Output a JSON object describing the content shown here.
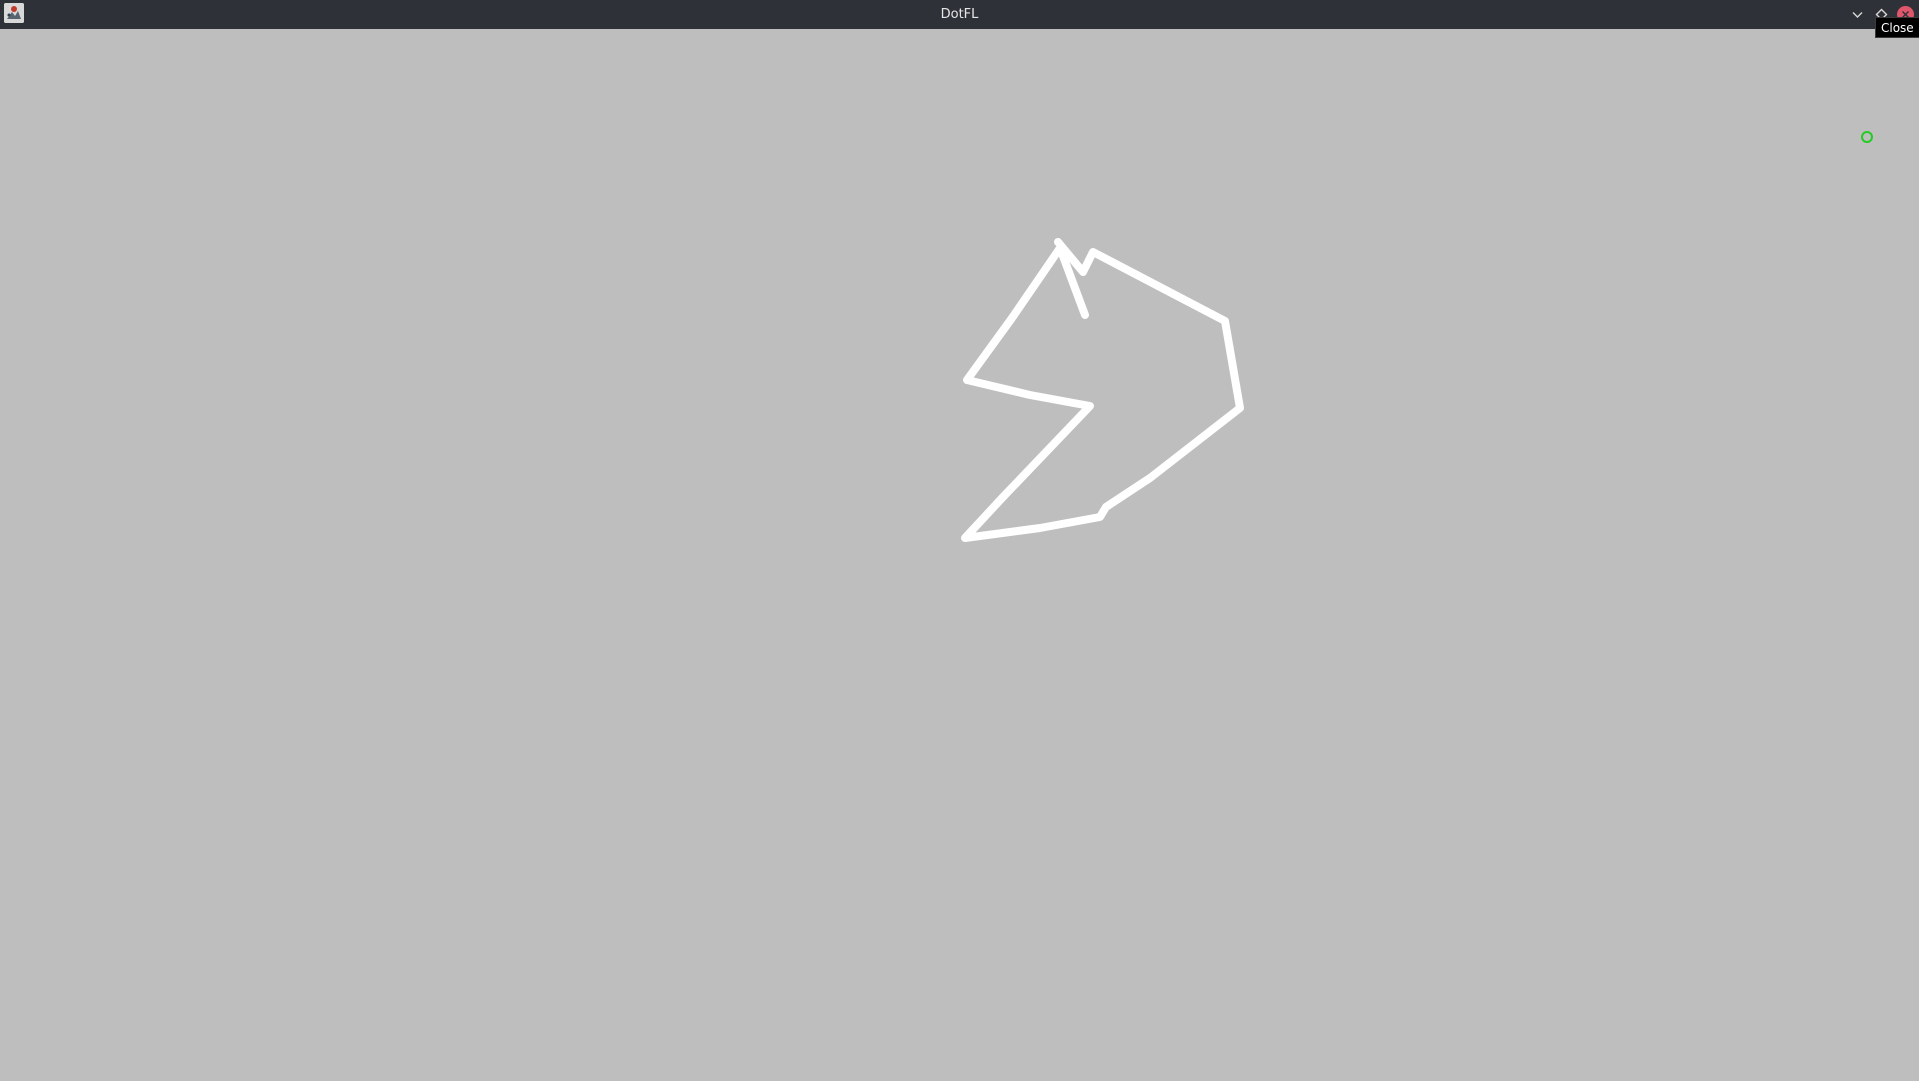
{
  "window": {
    "title": "DotFL",
    "buttons": {
      "minimize_icon": "chevron-down-icon",
      "maximize_icon": "diamond-icon",
      "close_icon": "close-icon"
    },
    "tooltip": "Close"
  },
  "canvas": {
    "background_color": "#bebebe",
    "stroke_color": "#ffffff",
    "cursor_color": "#22cc22"
  }
}
